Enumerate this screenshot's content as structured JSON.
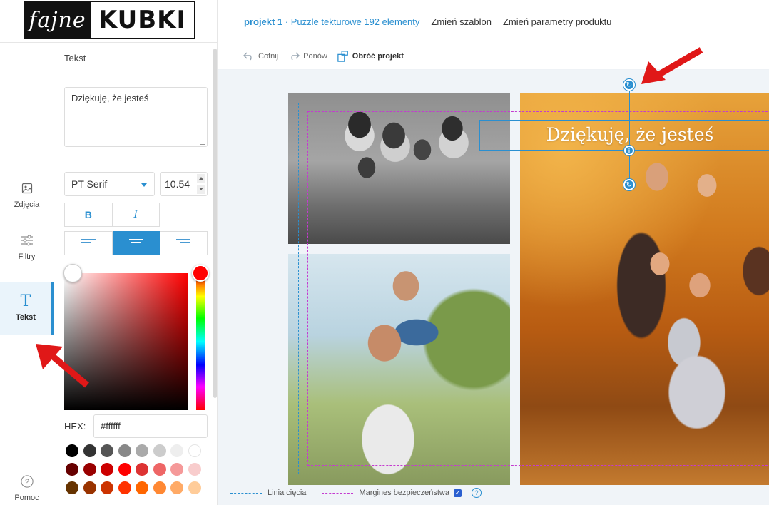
{
  "logo": {
    "left": "fajne",
    "right": "KUBKI"
  },
  "topbar": {
    "project_name": "projekt 1",
    "project_detail": " · Puzzle tekturowe 192 elementy",
    "change_template": "Zmień szablon",
    "change_params": "Zmień parametry produktu"
  },
  "nav": {
    "photos": "Zdjęcia",
    "filters": "Filtry",
    "text": "Tekst",
    "help": "Pomoc"
  },
  "panel": {
    "title": "Tekst",
    "text_value": "Dziękuję, że jesteś",
    "font": "PT Serif",
    "size": "10.54",
    "bold_label": "B",
    "italic_label": "I",
    "hex_label": "HEX:",
    "hex_value": "#ffffff",
    "swatches": [
      "#000000",
      "#333333",
      "#555555",
      "#888888",
      "#aaaaaa",
      "#cccccc",
      "#eeeeee",
      "#ffffff",
      "#660000",
      "#990000",
      "#cc0000",
      "#ff0000",
      "#dd3333",
      "#ee6666",
      "#f59999",
      "#f8cccc",
      "#663300",
      "#993300",
      "#cc3300",
      "#ff3300",
      "#ff6600",
      "#ff8833",
      "#ffaa66",
      "#ffcc99"
    ],
    "accent": "#2a8fd0",
    "hue": "#ff0000"
  },
  "toolbar": {
    "undo": "Cofnij",
    "redo": "Ponów",
    "rotate": "Obróć projekt"
  },
  "canvas": {
    "text": "Dziękuję, że jesteś"
  },
  "legend": {
    "cut_line": "Linia cięcia",
    "safe_margin": "Margines bezpieczeństwa"
  }
}
